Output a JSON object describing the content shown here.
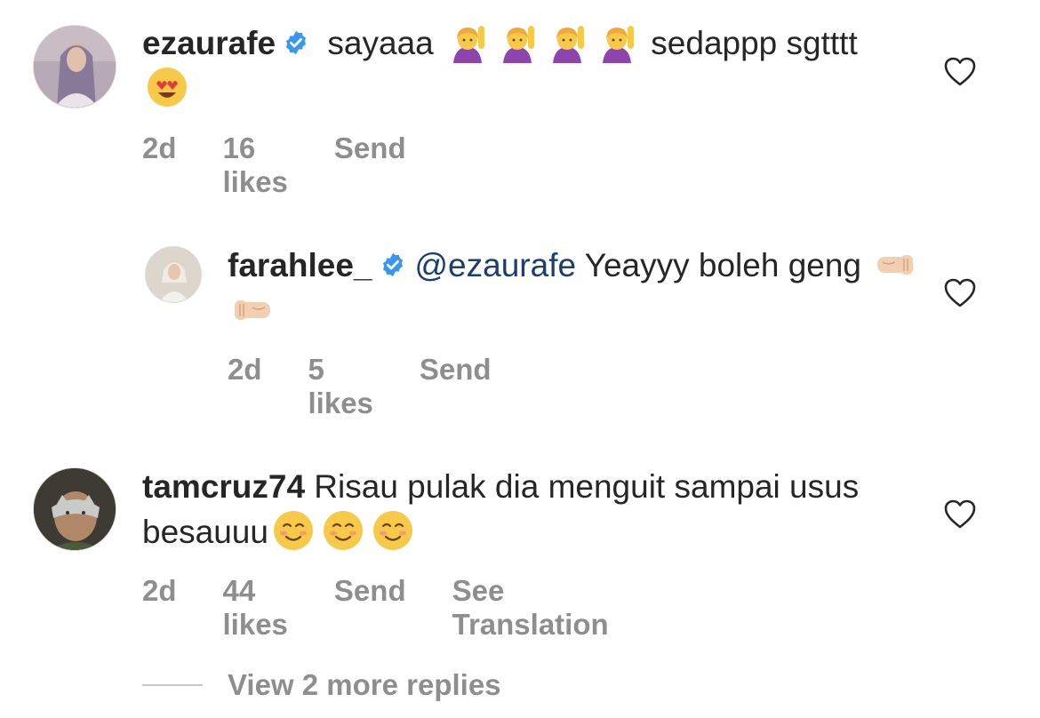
{
  "comments": [
    {
      "username": "ezaurafe",
      "text_before": " sayaaa ",
      "text_after": " sedappp sgtttt ",
      "time": "2d",
      "likes": "16 likes",
      "send": "Send",
      "verified": true,
      "emojis": [
        "raising-hand-emoji",
        "raising-hand-emoji",
        "raising-hand-emoji",
        "raising-hand-emoji",
        "heart-eyes-emoji"
      ]
    },
    {
      "username": "farahlee_",
      "mention": "@ezaurafe",
      "text": " Yeayyy boleh geng ",
      "time": "2d",
      "likes": "5 likes",
      "send": "Send",
      "verified": true,
      "emojis": [
        "left-fist-bump-emoji",
        "right-fist-bump-emoji"
      ]
    },
    {
      "username": "tamcruz74",
      "text": " Risau pulak dia menguit sampai usus besauuu",
      "time": "2d",
      "likes": "44 likes",
      "send": "Send",
      "translate": "See Translation",
      "verified": false,
      "emojis": [
        "smiling-face-emoji",
        "smiling-face-emoji",
        "smiling-face-emoji"
      ]
    }
  ],
  "more_replies": "View 2 more replies",
  "colors": {
    "text": "#262626",
    "meta": "#8e8e8e",
    "mention": "#1a3f6e",
    "verified": "#3897f0"
  }
}
